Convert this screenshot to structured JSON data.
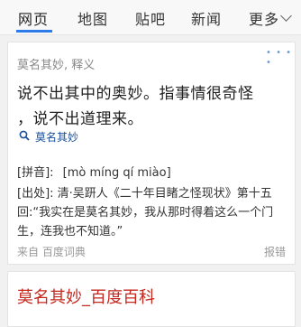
{
  "nav": {
    "tabs": [
      {
        "label": "网页"
      },
      {
        "label": "地图"
      },
      {
        "label": "贴吧"
      },
      {
        "label": "新闻"
      },
      {
        "label": "更多"
      }
    ]
  },
  "card": {
    "ad_marker": "• • • •",
    "header": "莫名其妙, 释义",
    "definition_line1": "说不出其中的奥妙。指事情很奇怪",
    "definition_line2": "，说不出道理来。",
    "search_link": "莫名其妙",
    "pinyin_label": "[拼音]:",
    "pinyin_value": "[mò míng qí miào]",
    "source_line1": "[出处]: 清·吴趼人《二十年目睹之怪现状》第十五",
    "source_line2": "回:“我实在是莫名其妙，我从那时得着这么一个门",
    "source_line3": "生，连我也不知道。”",
    "footer_source": "来自 百度词典",
    "footer_report": "报错"
  },
  "result": {
    "title": "莫名其妙_百度百科"
  }
}
